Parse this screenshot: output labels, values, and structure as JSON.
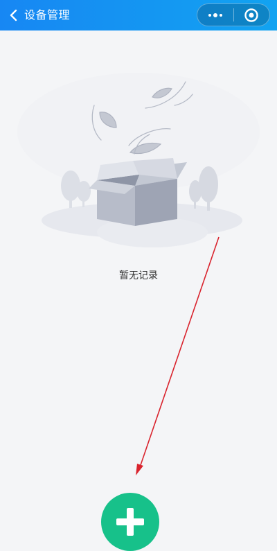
{
  "header": {
    "title": "设备管理",
    "back_icon": "chevron-left-icon",
    "more_icon": "more-dots-icon",
    "close_icon": "record-circle-icon",
    "gradient_start": "#1787f3",
    "gradient_end": "#12a3f1"
  },
  "empty_state": {
    "illustration": "empty-box-illustration",
    "text": "暂无记录"
  },
  "add_button": {
    "icon": "plus-icon",
    "color": "#17c18a"
  },
  "annotation": {
    "arrow_color": "#d9232d"
  }
}
